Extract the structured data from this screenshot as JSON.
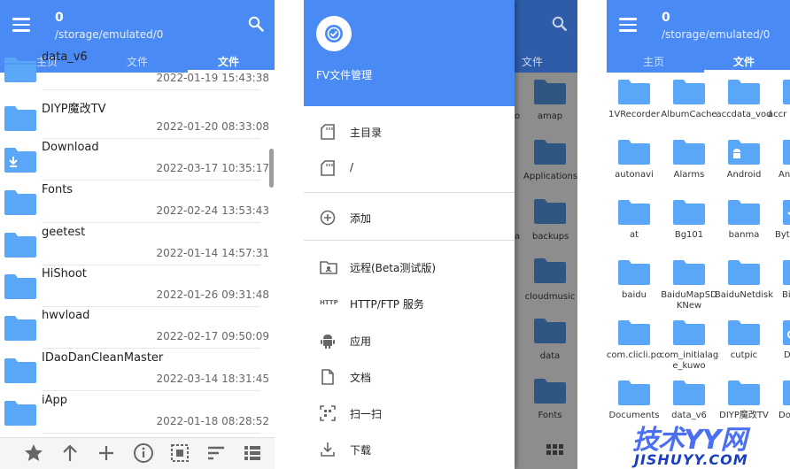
{
  "colors": {
    "accent": "#4a8af4",
    "folder": "#5aa6f7",
    "folder_tab": "#3d8ff0",
    "date": "#666666",
    "overlay": "#8d8d8d"
  },
  "pane1": {
    "count": "0",
    "path": "/storage/emulated/0",
    "tabs": [
      "主页",
      "文件",
      "文件"
    ],
    "list": [
      {
        "name": "data_v6",
        "date": "2022-01-19 15:43:38",
        "icon": "folder-icon"
      },
      {
        "name": "DIYP魔改TV",
        "date": "2022-01-20 08:33:08",
        "icon": "folder-icon"
      },
      {
        "name": "Download",
        "date": "2022-03-17 10:35:17",
        "icon": "download-folder-icon"
      },
      {
        "name": "Fonts",
        "date": "2022-02-24 13:53:43",
        "icon": "folder-icon"
      },
      {
        "name": "geetest",
        "date": "2022-01-14 14:57:31",
        "icon": "folder-icon"
      },
      {
        "name": "HiShoot",
        "date": "2022-01-26 09:31:48",
        "icon": "folder-icon"
      },
      {
        "name": "hwvload",
        "date": "2022-02-17 09:50:09",
        "icon": "folder-icon"
      },
      {
        "name": "IDaoDanCleanMaster",
        "date": "2022-03-14 18:31:45",
        "icon": "folder-icon"
      },
      {
        "name": "iApp",
        "date": "2022-01-18 08:28:52",
        "icon": "folder-icon"
      }
    ],
    "bottom_icons": [
      "star-icon",
      "up-arrow-icon",
      "plus-icon",
      "info-icon",
      "select-icon",
      "sort-icon",
      "view-list-icon"
    ]
  },
  "pane2": {
    "app_title": "FV文件管理",
    "behind_tab": "文件",
    "behind_folders": [
      "amap",
      "Applications",
      "backups",
      "cloudmusic",
      "data",
      "Fonts"
    ],
    "behind_prefix": [
      "o",
      "",
      "a",
      "",
      "",
      ""
    ],
    "menu": [
      {
        "label": "主目录",
        "icon": "sdcard-icon"
      },
      {
        "label": "/",
        "icon": "sdcard-icon"
      },
      {
        "label": "添加",
        "icon": "add-circle-icon"
      },
      {
        "label": "远程(Beta测试版)",
        "icon": "remote-folder-icon"
      },
      {
        "label": "HTTP/FTP 服务",
        "icon": "http-icon"
      },
      {
        "label": "应用",
        "icon": "android-icon"
      },
      {
        "label": "文档",
        "icon": "document-icon"
      },
      {
        "label": "扫一扫",
        "icon": "scan-icon"
      },
      {
        "label": "下载",
        "icon": "download-icon"
      }
    ],
    "http_text": "HTTP"
  },
  "pane3": {
    "count": "0",
    "path": "/storage/emulated/0",
    "tabs": [
      "主页",
      "文件"
    ],
    "grid": [
      [
        "1VRecorder",
        "AlbumCache",
        "accdata_vod",
        "accr"
      ],
      [
        "autonavi",
        "Alarms",
        "Android",
        "An"
      ],
      [
        "at",
        "Bg101",
        "banma",
        "Byte"
      ],
      [
        "baidu",
        "BaiduMapSDKNew",
        "BaiduNetdisk",
        "Bi"
      ],
      [
        "com.clicli.po",
        "com_initialage_kuwo",
        "cutpic",
        "D"
      ],
      [
        "Documents",
        "data_v6",
        "DIYP魔改TV",
        "Dov"
      ]
    ]
  },
  "watermark": {
    "line1": "技术YY网",
    "line2": "JISHUYY.COM"
  }
}
